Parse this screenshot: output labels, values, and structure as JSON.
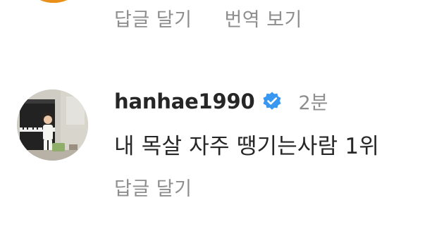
{
  "previous_comment": {
    "actions": {
      "reply_label": "답글 달기",
      "translate_label": "번역 보기"
    }
  },
  "comment": {
    "username": "hanhae1990",
    "verified_icon": "verified-badge-icon",
    "verified_color": "#3897f0",
    "time": "2분",
    "text": "내 목살 자주 땡기는사람 1위",
    "actions": {
      "reply_label": "답글 달기"
    }
  },
  "colors": {
    "primary_text": "#262626",
    "secondary_text": "#8e8e8e",
    "background": "#ffffff"
  }
}
